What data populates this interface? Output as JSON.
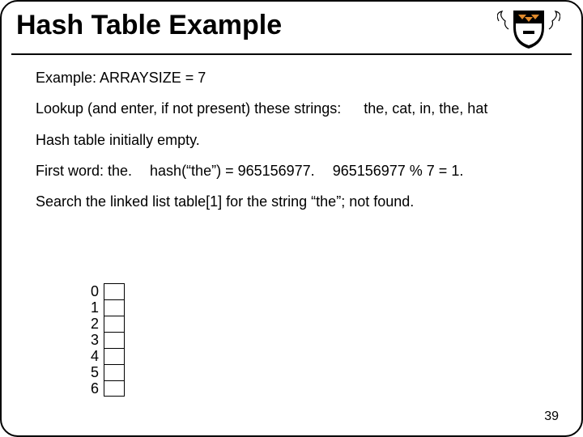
{
  "title": "Hash Table Example",
  "lines": {
    "example_label": "Example: ARRAYSIZE = 7",
    "lookup_label": "Lookup (and enter, if not present) these strings:",
    "lookup_strings": "the, cat, in, the, hat",
    "hash_empty": "Hash table initially empty.",
    "first_word": "First word:  the.",
    "hash_call": "hash(“the”) = 965156977.",
    "hash_mod": "965156977 % 7 = 1.",
    "search_line": "Search the linked list   table[1]  for the string “the”; not found."
  },
  "table_indices": [
    "0",
    "1",
    "2",
    "3",
    "4",
    "5",
    "6"
  ],
  "page_number": "39"
}
